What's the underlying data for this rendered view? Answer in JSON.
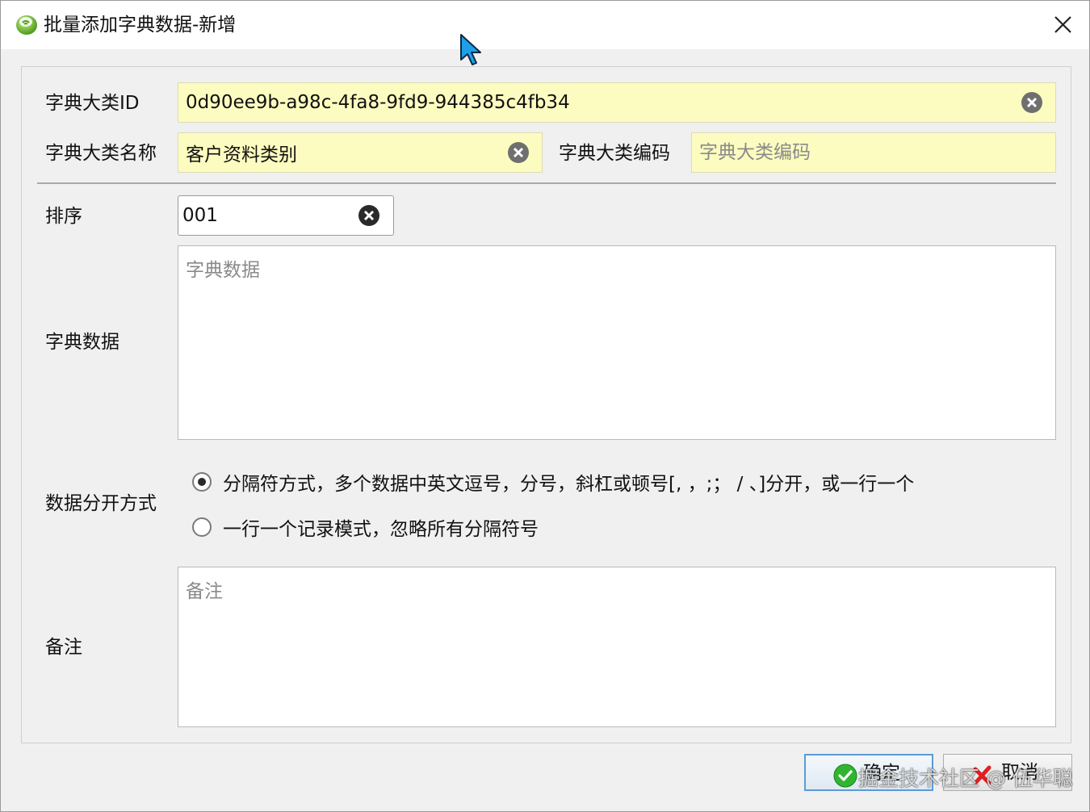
{
  "window": {
    "title": "批量添加字典数据-新增"
  },
  "form": {
    "category_id": {
      "label": "字典大类ID",
      "value": "0d90ee9b-a98c-4fa8-9fd9-944385c4fb34"
    },
    "category_name": {
      "label": "字典大类名称",
      "value": "客户资料类别"
    },
    "category_code": {
      "label": "字典大类编码",
      "value": "",
      "placeholder": "字典大类编码"
    },
    "sort": {
      "label": "排序",
      "value": "001"
    },
    "dict_data": {
      "label": "字典数据",
      "value": "",
      "placeholder": "字典数据"
    },
    "split_mode": {
      "label": "数据分开方式",
      "options": [
        {
          "label": "分隔符方式，多个数据中英文逗号，分号，斜杠或顿号[, ，;； / 、]分开，或一行一个",
          "selected": true
        },
        {
          "label": "一行一个记录模式，忽略所有分隔符号",
          "selected": false
        }
      ]
    },
    "remarks": {
      "label": "备注",
      "value": "",
      "placeholder": "备注"
    }
  },
  "buttons": {
    "ok_label": "确定",
    "cancel_label": "取消"
  },
  "watermark": "掘金技术社区 @ 伍华聪",
  "colors": {
    "required_field_bg": "#fcfcc0",
    "primary_border": "#5a9bd5",
    "ok_icon": "#2fb52f",
    "cancel_icon": "#e02020"
  }
}
